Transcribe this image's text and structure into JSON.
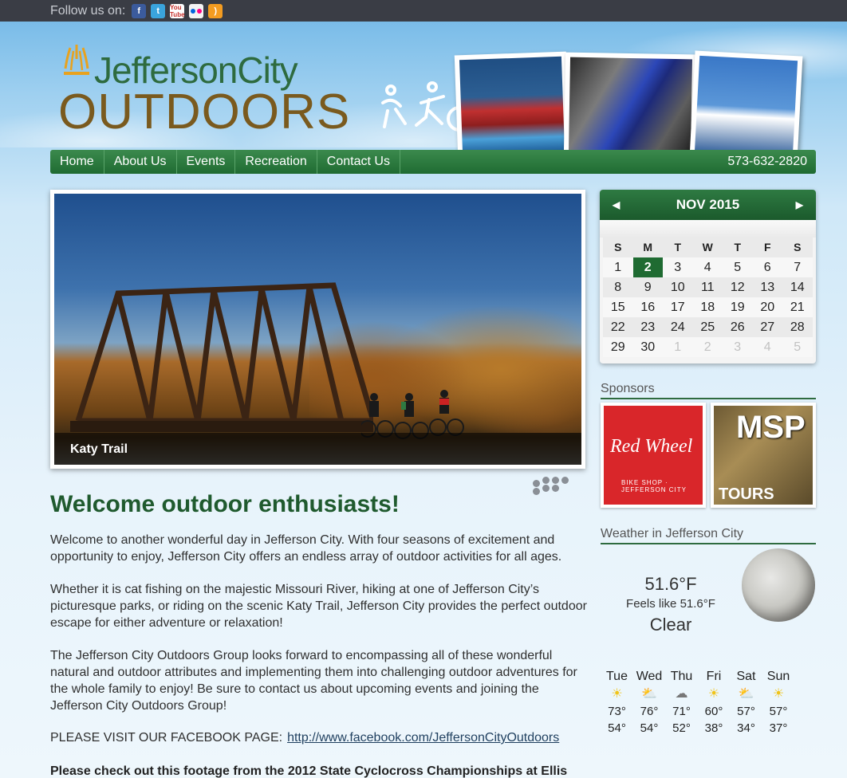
{
  "topbar": {
    "follow_label": "Follow us on:",
    "social_icons": [
      "facebook-icon",
      "twitter-icon",
      "youtube-icon",
      "flickr-icon",
      "rss-icon"
    ],
    "youtube_text": "You Tube"
  },
  "header": {
    "logo_top": "JeffersonCity",
    "logo_main": "OUTDOORS"
  },
  "nav": {
    "items": [
      "Home",
      "About Us",
      "Events",
      "Recreation",
      "Contact Us"
    ],
    "phone": "573-632-2820"
  },
  "slideshow": {
    "caption": "Katy Trail"
  },
  "main": {
    "heading": "Welcome outdoor enthusiasts!",
    "paragraphs": [
      "Welcome to another wonderful day in Jefferson City. With four seasons of excitement and opportunity to enjoy, Jefferson City offers an endless array of outdoor activities for all ages.",
      "Whether it is cat fishing on the majestic Missouri River, hiking at one of Jefferson City’s picturesque parks, or riding on the scenic Katy Trail, Jefferson City provides the perfect outdoor escape for either adventure or relaxation!",
      "The Jefferson City Outdoors Group looks forward to encompassing all of these wonderful natural and outdoor attributes and implementing them into challenging outdoor adventures for the whole family to enjoy! Be sure to contact us about upcoming events and joining the Jefferson City Outdoors Group!"
    ],
    "facebook_label": "PLEASE VISIT OUR FACEBOOK PAGE:",
    "facebook_link": "http://www.facebook.com/JeffersonCityOutdoors",
    "footage_text": "Please check out this footage from the 2012 State Cyclocross Championships at Ellis"
  },
  "calendar": {
    "month": "NOV 2015",
    "days_of_week": [
      "S",
      "M",
      "T",
      "W",
      "T",
      "F",
      "S"
    ],
    "weeks": [
      [
        "1",
        "2",
        "3",
        "4",
        "5",
        "6",
        "7"
      ],
      [
        "8",
        "9",
        "10",
        "11",
        "12",
        "13",
        "14"
      ],
      [
        "15",
        "16",
        "17",
        "18",
        "19",
        "20",
        "21"
      ],
      [
        "22",
        "23",
        "24",
        "25",
        "26",
        "27",
        "28"
      ],
      [
        "29",
        "30",
        "1",
        "2",
        "3",
        "4",
        "5"
      ]
    ],
    "today": "2"
  },
  "sponsors": {
    "title": "Sponsors",
    "items": [
      {
        "name": "Red Wheel",
        "sub": "BIKE SHOP · JEFFERSON CITY"
      },
      {
        "name": "MSP",
        "sub": "TOURS"
      }
    ]
  },
  "weather": {
    "title": "Weather in Jefferson City",
    "temp": "51.6°F",
    "feels": "Feels like 51.6°F",
    "condition": "Clear",
    "forecast": [
      {
        "day": "Tue",
        "icon": "sun-icon",
        "hi": "73°",
        "lo": "54°"
      },
      {
        "day": "Wed",
        "icon": "partly-cloudy-icon",
        "hi": "76°",
        "lo": "54°"
      },
      {
        "day": "Thu",
        "icon": "storm-icon",
        "hi": "71°",
        "lo": "52°"
      },
      {
        "day": "Fri",
        "icon": "sun-icon",
        "hi": "60°",
        "lo": "38°"
      },
      {
        "day": "Sat",
        "icon": "partly-cloudy-icon",
        "hi": "57°",
        "lo": "34°"
      },
      {
        "day": "Sun",
        "icon": "sun-icon",
        "hi": "57°",
        "lo": "37°"
      }
    ]
  },
  "colors": {
    "nav_green": "#1f6b32",
    "heading_green": "#1f5a2e",
    "logo_brown": "#7a5a1e",
    "topbar": "#3a3d45"
  }
}
